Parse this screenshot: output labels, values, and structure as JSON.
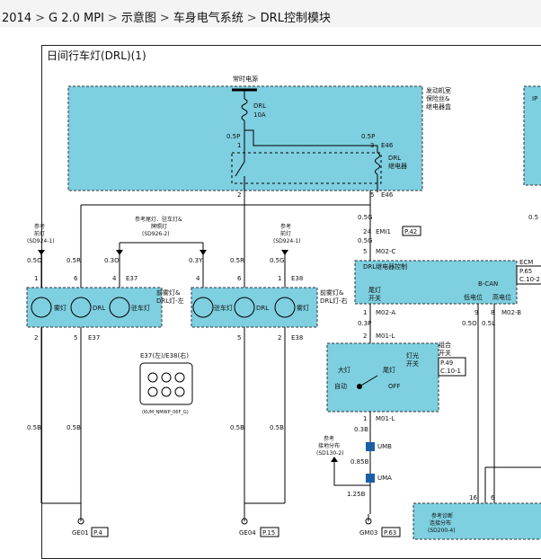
{
  "breadcrumb": {
    "items": [
      "2014",
      "G 2.0 MPI",
      "示意图",
      "车身电气系统",
      "DRL控制模块"
    ]
  },
  "diagram": {
    "title": "日间行车灯(DRL)(1)",
    "labels": {
      "fuse_src": "常时电源",
      "fuse_name": "DRL",
      "fuse_amp": "10A",
      "engine_box_1": "发动机室",
      "engine_box_2": "保险丝&",
      "engine_box_3": "继电器盒",
      "relay_1": "DRL",
      "relay_2": "继电器",
      "e46a": "E46",
      "e46b": "E46",
      "w_05p_l": "0.5P",
      "w_05p_r": "0.5P",
      "p1": "1",
      "p3": "3",
      "p2": "2",
      "p5": "5",
      "ref_l_1": "参考",
      "ref_l_2": "前灯",
      "ref_l_3": "(SD924-1)",
      "ref_m_1": "参考尾灯、驻车灯&",
      "ref_m_2": "牌照灯",
      "ref_m_3": "(SD926-2)",
      "ref_r_1": "参考",
      "ref_r_2": "前灯",
      "ref_r_3": "(SD924-1)",
      "w_05o": "0.5O",
      "w_05r_1": "0.5R",
      "w_03o": "0.3O",
      "w_03y": "0.3Y",
      "w_05r_2": "0.5R",
      "w_05g": "0.5G",
      "pin_1a": "1",
      "pin_6a": "6",
      "pin_4a": "4",
      "e37a": "E37",
      "pin_4b": "4",
      "pin_6b": "6",
      "pin_1b": "1",
      "e38a": "E38",
      "lamp_dl": "雾灯",
      "lamp_drl_l": "DRL",
      "lamp_park_l": "驻车灯",
      "lamp_park_r": "驻车灯",
      "lamp_drl_r": "DRL",
      "lamp_dr": "雾灯",
      "asm_l_1": "前雾灯&",
      "asm_l_2": "DRL灯-左",
      "asm_r_1": "前雾灯&",
      "asm_r_2": "DRL灯-右",
      "pin_2a": "2",
      "pin_5a": "5",
      "e37b": "E37",
      "pin_5b": "5",
      "pin_2b": "2",
      "e38b": "E38",
      "conn_title": "E37(左)/E38(右)",
      "conn_part": "(KUM_NMWP_06F_G)",
      "w_05b_1": "0.5B",
      "w_05b_2": "0.5B",
      "w_05b_3": "0.5B",
      "w_05b_4": "0.5B",
      "g1": "GE01",
      "g1p": "P.4",
      "g2": "GE04",
      "g2p": "P.15",
      "g3": "GM03",
      "g3p": "P.63",
      "w_05g_2": "0.5G",
      "p24": "24",
      "emi1": "EMI1",
      "emi1p": "P.42",
      "w_05g_3": "0.5G",
      "p5c": "5",
      "m02c": "M02-C",
      "ecm": "ECM",
      "ecm_p1": "P.65",
      "ecm_p2": "C.10-2",
      "drl_ctrl": "DRL继电器控制",
      "tail_1": "尾灯",
      "tail_2": "开关",
      "bcan": "B-CAN",
      "low_v": "低电位",
      "high_v": "高电位",
      "p1a": "1",
      "m02a": "M02-A",
      "w_03p": "0.3P",
      "p2l": "2",
      "m01l": "M01-L",
      "p9": "9",
      "p8": "8",
      "m02b": "M02-B",
      "w_05o_2": "0.5O",
      "w_05l": "0.5L",
      "multi_1": "组合",
      "multi_2": "开关",
      "multi_p1": "P.49",
      "multi_p2": "C.10-1",
      "lamp_sw_1": "灯光",
      "lamp_sw_2": "开关",
      "sw_head": "大灯",
      "sw_tail": "尾灯",
      "sw_auto": "自动",
      "sw_off": "OFF",
      "p1m": "1",
      "m01l2": "M01-L",
      "w_03b": "0.3B",
      "umb": "UMB",
      "ref_s_1": "参考",
      "ref_s_2": "接地分布",
      "ref_s_3": "(SD130-2)",
      "w_085b": "0.85B",
      "uma": "UMA",
      "w_125b": "1.25B",
      "diag_1": "参考诊断",
      "diag_2": "连接分布",
      "diag_3": "(SD200-4)",
      "p16": "16",
      "p6": "6",
      "ip_1": "IP",
      "w_05_edge": "0.5"
    }
  }
}
